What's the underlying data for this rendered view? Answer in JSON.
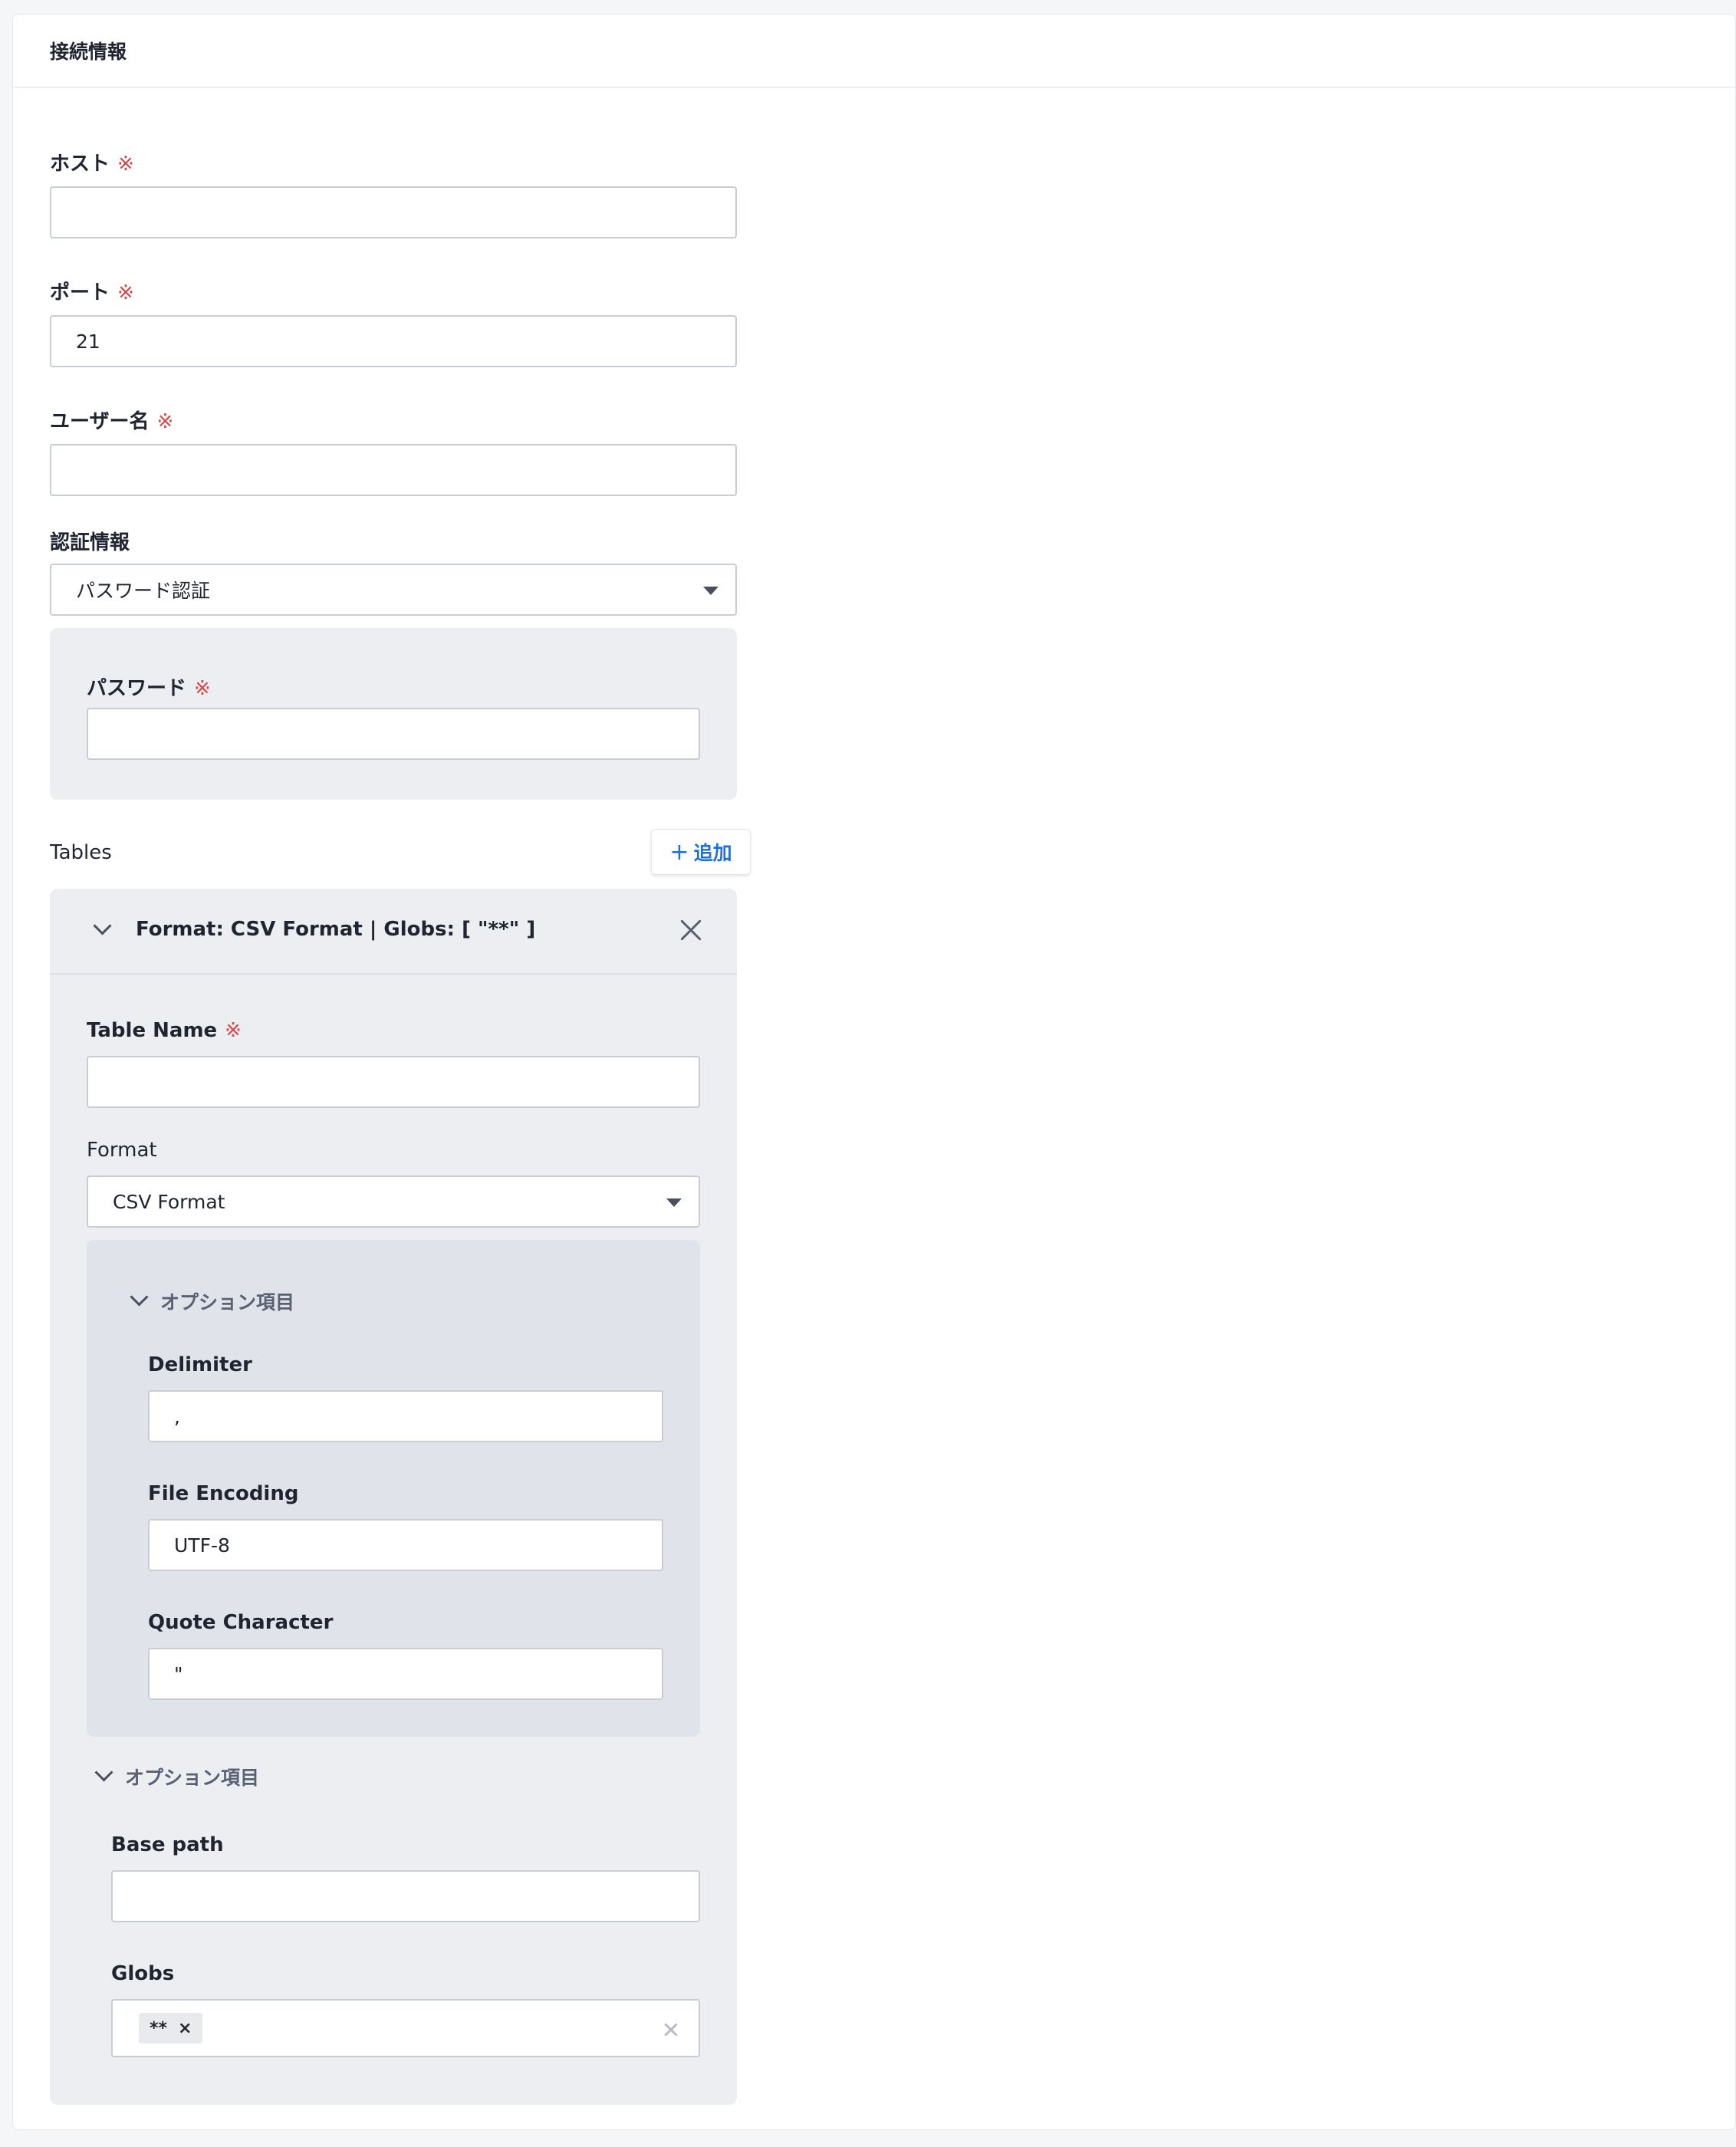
{
  "header": {
    "title": "接続情報"
  },
  "required_mark": "※",
  "host": {
    "label": "ホスト",
    "value": ""
  },
  "port": {
    "label": "ポート",
    "value": "21"
  },
  "username": {
    "label": "ユーザー名",
    "value": ""
  },
  "auth": {
    "label": "認証情報",
    "selected": "パスワード認証",
    "password": {
      "label": "パスワード",
      "value": ""
    }
  },
  "tables": {
    "label": "Tables",
    "add_plus": "+",
    "add_label": "追加",
    "item": {
      "title": "Format: CSV Format | Globs: [ \"**\" ]",
      "table_name": {
        "label": "Table Name",
        "value": ""
      },
      "format": {
        "label": "Format",
        "selected": "CSV Format",
        "options_toggle": "オプション項目",
        "delimiter": {
          "label": "Delimiter",
          "value": ","
        },
        "file_encoding": {
          "label": "File Encoding",
          "value": "UTF-8"
        },
        "quote_character": {
          "label": "Quote Character",
          "value": "\""
        }
      },
      "options_toggle": "オプション項目",
      "base_path": {
        "label": "Base path",
        "value": ""
      },
      "globs": {
        "label": "Globs",
        "tags": [
          "**"
        ],
        "tag_remove": "×"
      }
    }
  },
  "colors": {
    "required": "#d64545",
    "link": "#1f6fd6",
    "panel_bg": "#eceef2",
    "nested_panel_bg": "#e0e3ea"
  }
}
